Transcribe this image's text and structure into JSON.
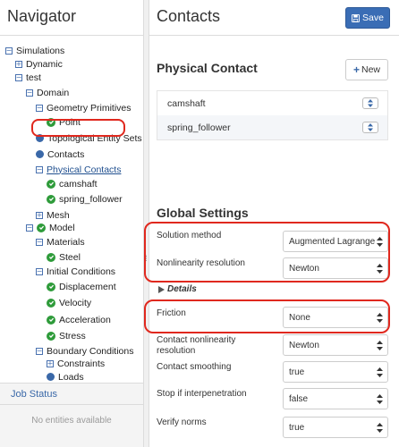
{
  "navigator": {
    "title": "Navigator",
    "tree": [
      {
        "label": "Simulations",
        "icon": "toggle-minus"
      },
      {
        "label": "Dynamic",
        "icon": "toggle-plus"
      },
      {
        "label": "test",
        "icon": "toggle-minus"
      },
      {
        "label": "Domain",
        "icon": "toggle-minus"
      },
      {
        "label": "Geometry Primitives",
        "icon": "toggle-minus"
      },
      {
        "label": "Point",
        "icon": "check-icon"
      },
      {
        "label": "Topological Entity Sets",
        "icon": "dot-icon"
      },
      {
        "label": "Contacts",
        "icon": "dot-icon"
      },
      {
        "label": "Physical Contacts",
        "icon": "toggle-minus"
      },
      {
        "label": "camshaft",
        "icon": "check-icon"
      },
      {
        "label": "spring_follower",
        "icon": "check-icon"
      },
      {
        "label": "Mesh",
        "icon": "toggle-plus"
      },
      {
        "label": "Model",
        "icon": "check-icon"
      },
      {
        "label": "Materials",
        "icon": "toggle-minus"
      },
      {
        "label": "Steel",
        "icon": "check-icon"
      },
      {
        "label": "Initial Conditions",
        "icon": "toggle-minus"
      },
      {
        "label": "Displacement",
        "icon": "check-icon"
      },
      {
        "label": "Velocity",
        "icon": "check-icon"
      },
      {
        "label": "Acceleration",
        "icon": "check-icon"
      },
      {
        "label": "Stress",
        "icon": "check-icon"
      },
      {
        "label": "Boundary Conditions",
        "icon": "toggle-minus"
      },
      {
        "label": "Constraints",
        "icon": "toggle-plus"
      },
      {
        "label": "Loads",
        "icon": "dot-icon"
      }
    ],
    "toggle_minus_glyph": "−",
    "toggle_plus_glyph": "+"
  },
  "job_status": {
    "title": "Job Status",
    "empty_text": "No entities available"
  },
  "splitter": {
    "grip": "⁞"
  },
  "main": {
    "title": "Contacts",
    "save_label": "Save",
    "physical_contact": {
      "title": "Physical Contact",
      "new_label": "New",
      "new_glyph": "+",
      "items": [
        "camshaft",
        "spring_follower"
      ]
    },
    "global_settings": {
      "title": "Global Settings",
      "details_label": "Details",
      "fields": [
        {
          "label": "Solution method",
          "value": "Augmented Lagrange"
        },
        {
          "label": "Nonlinearity resolution",
          "value": "Newton"
        },
        {
          "label": "Friction",
          "value": "None"
        },
        {
          "label": "Contact nonlinearity resolution",
          "value": "Newton"
        },
        {
          "label": "Contact smoothing",
          "value": "true"
        },
        {
          "label": "Stop if interpenetration",
          "value": "false"
        },
        {
          "label": "Verify norms",
          "value": "true"
        }
      ]
    }
  },
  "colors": {
    "accent": "#3a6db5",
    "check_green": "#2e9b3a",
    "highlight_red": "#e0281e",
    "node_blue": "#3a68a8"
  }
}
